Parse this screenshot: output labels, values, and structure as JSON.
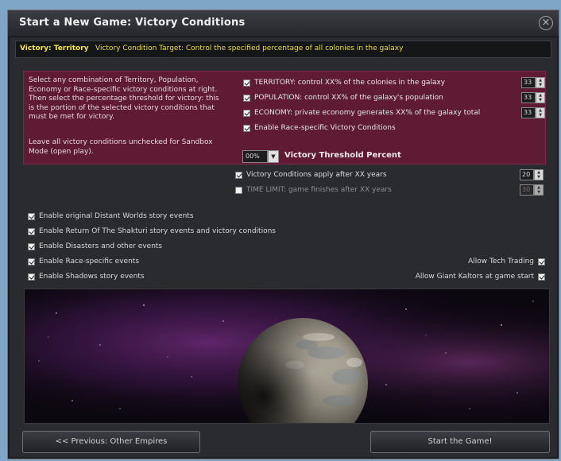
{
  "window": {
    "title": "Start a New Game: Victory Conditions",
    "close_symbol": "×"
  },
  "victory_bar": {
    "label": "Victory: Territory",
    "description": "Victory Condition Target: Control the specified percentage of all colonies in the galaxy"
  },
  "info": {
    "text1": "Select any combination of Territory, Population, Economy or Race-specific victory conditions at right. Then select the percentage threshold for victory: this is the portion of the selected victory conditions that must be met for victory.",
    "text2": "Leave all victory conditions unchecked for Sandbox Mode (open play)."
  },
  "conditions": [
    {
      "label": "TERRITORY: control XX% of the colonies in the galaxy",
      "checked": true,
      "value": "33"
    },
    {
      "label": "POPULATION: control XX% of the galaxy's population",
      "checked": true,
      "value": "33"
    },
    {
      "label": "ECONOMY: private economy generates XX% of the galaxy total",
      "checked": true,
      "value": "33"
    },
    {
      "label": "Enable Race-specific Victory Conditions",
      "checked": true
    }
  ],
  "threshold": {
    "value": "00%",
    "label": "Victory Threshold Percent"
  },
  "years": [
    {
      "label": "Victory Conditions apply after XX years",
      "checked": true,
      "value": "20"
    },
    {
      "label": "TIME LIMIT: game finishes after XX years",
      "checked": false,
      "value": "30"
    }
  ],
  "events": [
    {
      "label": "Enable original Distant Worlds story events",
      "checked": true
    },
    {
      "label": "Enable Return Of The Shakturi story events and victory conditions",
      "checked": true
    },
    {
      "label": "Enable Disasters and other events",
      "checked": true
    },
    {
      "label": "Enable Race-specific events",
      "checked": true
    },
    {
      "label": "Enable Shadows story events",
      "checked": true
    }
  ],
  "right_options": [
    {
      "label": "Allow Tech Trading",
      "checked": true
    },
    {
      "label": "Allow Giant Kaltors at game start",
      "checked": true
    }
  ],
  "footer": {
    "previous": "<< Previous: Other Empires",
    "start": "Start the Game!"
  },
  "colors": {
    "accent_yellow": "#f2e64e",
    "panel_maroon": "#5f1a34",
    "background": "#2a2b2f"
  }
}
